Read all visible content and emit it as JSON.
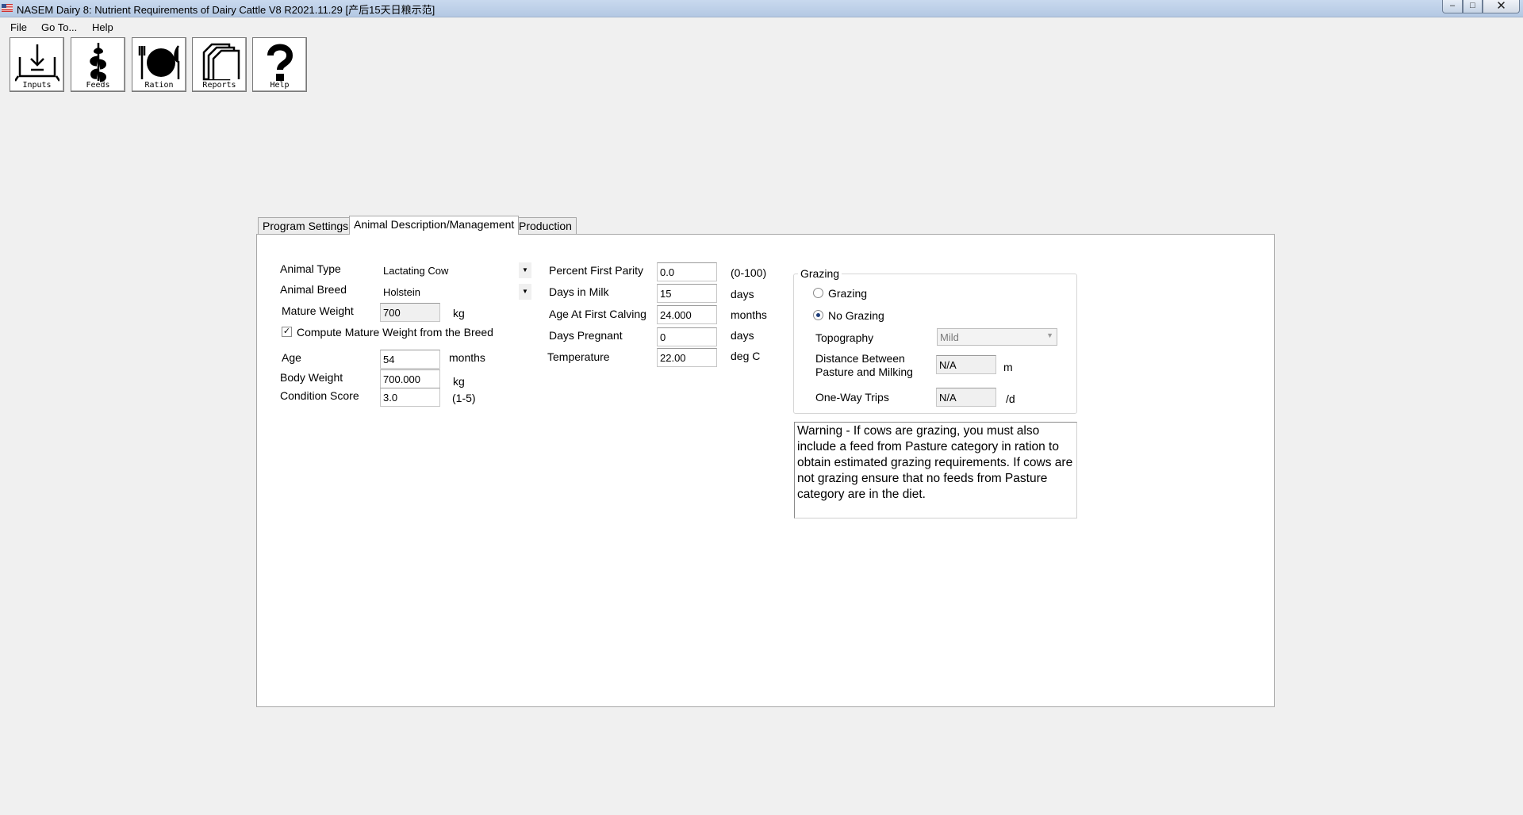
{
  "window": {
    "title": "NASEM Dairy 8: Nutrient Requirements of Dairy Cattle  V8 R2021.11.29 [产后15天日粮示范]",
    "minimize": "–",
    "maximize": "□",
    "close": "✕"
  },
  "menu": [
    "File",
    "Go To...",
    "Help"
  ],
  "toolbar": [
    {
      "label": "Inputs",
      "icon": "inputs-icon"
    },
    {
      "label": "Feeds",
      "icon": "feeds-icon"
    },
    {
      "label": "Ration",
      "icon": "ration-icon"
    },
    {
      "label": "Reports",
      "icon": "reports-icon"
    },
    {
      "label": "Help",
      "icon": "help-icon"
    }
  ],
  "tabs": [
    "Program Settings",
    "Animal Description/Management",
    "Production"
  ],
  "active_tab": "Animal Description/Management",
  "animal": {
    "type_label": "Animal Type",
    "type_value": "Lactating Cow",
    "breed_label": "Animal Breed",
    "breed_value": "Holstein",
    "mature_weight_label": "Mature Weight",
    "mature_weight_value": "700",
    "mature_weight_unit": "kg",
    "compute_label": "Compute Mature Weight from the Breed",
    "compute_checked": true,
    "age_label": "Age",
    "age_value": "54",
    "age_unit": "months",
    "body_weight_label": "Body Weight",
    "body_weight_value": "700.000",
    "body_weight_unit": "kg",
    "condition_label": "Condition Score",
    "condition_value": "3.0",
    "condition_unit": "(1-5)"
  },
  "management": {
    "parity_label": "Percent First Parity",
    "parity_value": "0.0",
    "parity_unit": "(0-100)",
    "dim_label": "Days in Milk",
    "dim_value": "15",
    "dim_unit": "days",
    "afc_label": "Age At First Calving",
    "afc_value": "24.000",
    "afc_unit": "months",
    "pregnant_label": "Days Pregnant",
    "pregnant_value": "0",
    "pregnant_unit": "days",
    "temp_label": "Temperature",
    "temp_value": "22.00",
    "temp_unit": "deg C"
  },
  "grazing": {
    "legend": "Grazing",
    "option_grazing": "Grazing",
    "option_no_grazing": "No Grazing",
    "selected": "No Grazing",
    "topography_label": "Topography",
    "topography_value": "Mild",
    "distance_label_1": "Distance Between",
    "distance_label_2": "Pasture and Milking",
    "distance_value": "N/A",
    "distance_unit": "m",
    "trips_label": "One-Way Trips",
    "trips_value": "N/A",
    "trips_unit": "/d"
  },
  "warning": "Warning - If cows are grazing, you must also include a feed from Pasture category in ration to obtain estimated grazing requirements. If cows are not grazing ensure that no feeds from Pasture category are in the diet."
}
